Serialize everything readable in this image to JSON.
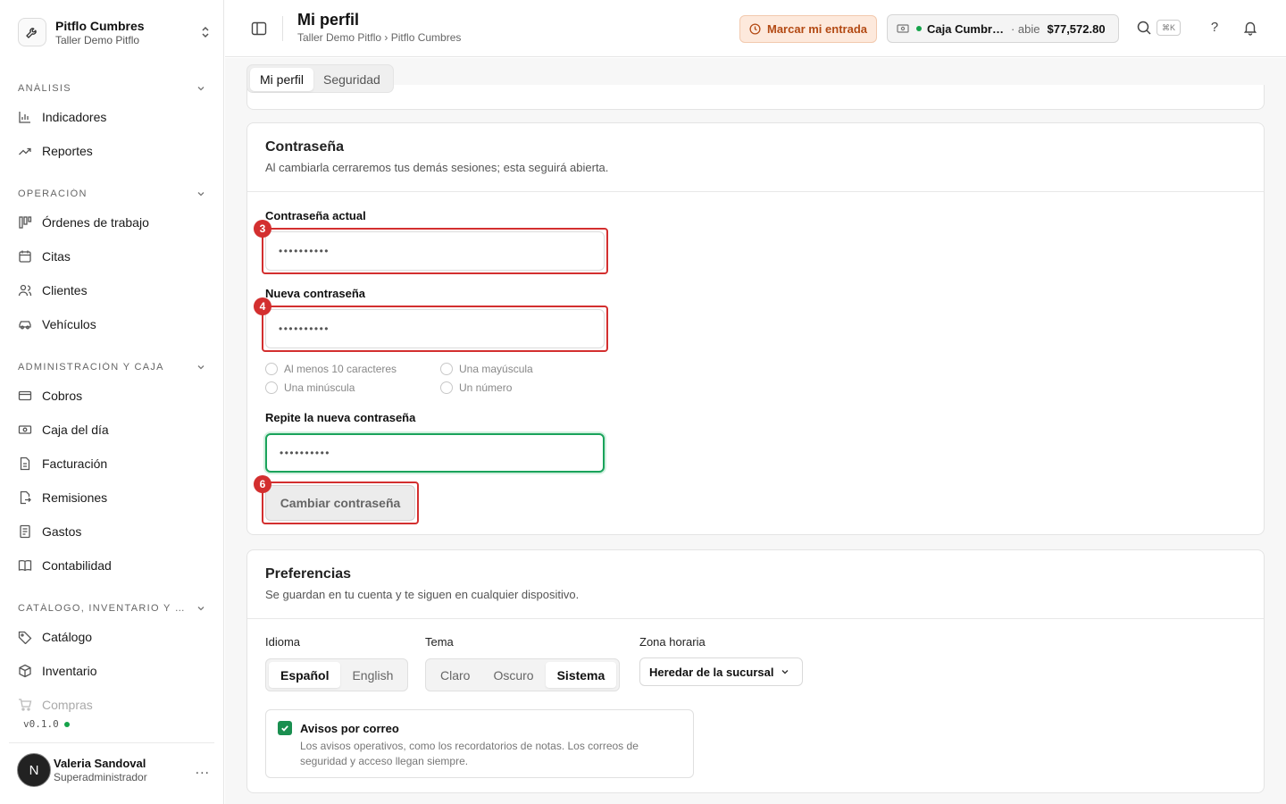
{
  "org": {
    "name": "Pitflo Cumbres",
    "subtitle": "Taller Demo Pitflo"
  },
  "nav": {
    "sections": [
      {
        "title": "ANÁLISIS",
        "items": [
          {
            "label": "Indicadores",
            "icon": "bar-chart-icon"
          },
          {
            "label": "Reportes",
            "icon": "trend-icon"
          }
        ]
      },
      {
        "title": "OPERACIÓN",
        "items": [
          {
            "label": "Órdenes de trabajo",
            "icon": "kanban-icon"
          },
          {
            "label": "Citas",
            "icon": "calendar-icon"
          },
          {
            "label": "Clientes",
            "icon": "users-icon"
          },
          {
            "label": "Vehículos",
            "icon": "car-icon"
          }
        ]
      },
      {
        "title": "ADMINISTRACIÓN Y CAJA",
        "items": [
          {
            "label": "Cobros",
            "icon": "credit-card-icon"
          },
          {
            "label": "Caja del día",
            "icon": "cash-icon"
          },
          {
            "label": "Facturación",
            "icon": "file-icon"
          },
          {
            "label": "Remisiones",
            "icon": "file-export-icon"
          },
          {
            "label": "Gastos",
            "icon": "receipt-icon"
          },
          {
            "label": "Contabilidad",
            "icon": "book-icon"
          }
        ]
      },
      {
        "title": "CATÁLOGO, INVENTARIO Y CO…",
        "items": [
          {
            "label": "Catálogo",
            "icon": "tag-icon"
          },
          {
            "label": "Inventario",
            "icon": "box-icon"
          },
          {
            "label": "Compras",
            "icon": "cart-icon"
          }
        ]
      }
    ]
  },
  "version": "v0.1.0",
  "user": {
    "initial": "N",
    "name": "Valeria Sandoval",
    "role": "Superadministrador",
    "more": "..."
  },
  "header": {
    "title": "Mi perfil",
    "breadcrumb": "Taller Demo Pitflo › Pitflo Cumbres",
    "clockin_label": "Marcar mi entrada",
    "cash_name": "Caja Cumbr…",
    "cash_status": "· abie",
    "cash_amount": "$77,572.80",
    "shortcut": "⌘K",
    "help": "?"
  },
  "tabs": [
    {
      "label": "Mi perfil",
      "active": true
    },
    {
      "label": "Seguridad",
      "active": false
    }
  ],
  "password_card": {
    "title": "Contraseña",
    "description": "Al cambiarla cerraremos tus demás sesiones; esta seguirá abierta.",
    "current_label": "Contraseña actual",
    "current_value": "••••••••••",
    "new_label": "Nueva contraseña",
    "new_value": "••••••••••",
    "requirements": [
      "Al menos 10 caracteres",
      "Una mayúscula",
      "Una minúscula",
      "Un número"
    ],
    "repeat_label": "Repite la nueva contraseña",
    "repeat_value": "••••••••••",
    "submit_label": "Cambiar contraseña"
  },
  "annotations": [
    "3",
    "4",
    "6"
  ],
  "preferences_card": {
    "title": "Preferencias",
    "description": "Se guardan en tu cuenta y te siguen en cualquier dispositivo.",
    "language_label": "Idioma",
    "languages": [
      "Español",
      "English"
    ],
    "theme_label": "Tema",
    "themes": [
      "Claro",
      "Oscuro",
      "Sistema"
    ],
    "timezone_label": "Zona horaria",
    "timezone_value": "Heredar de la sucursal",
    "email_notify_title": "Avisos por correo",
    "email_notify_desc": "Los avisos operativos, como los recordatorios de notas. Los correos de seguridad y acceso llegan siempre.",
    "email_notify_checked": true
  },
  "colors": {
    "accent_green": "#1a8f50",
    "annotation_red": "#d32f2f",
    "clockin_bg": "#fde9dc",
    "clockin_text": "#b34a14"
  }
}
